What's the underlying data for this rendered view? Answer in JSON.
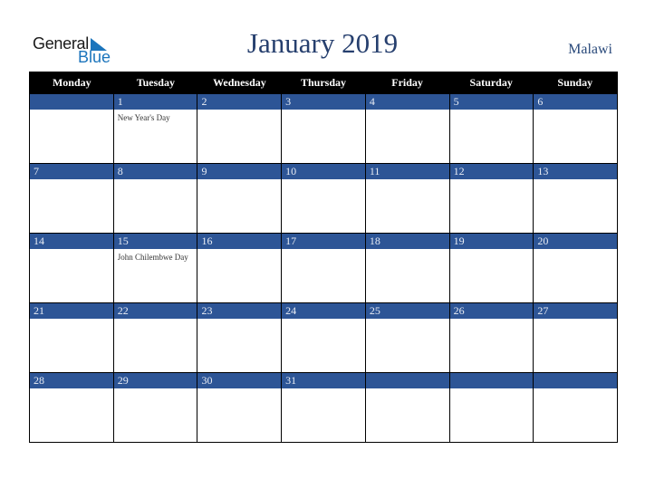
{
  "brand": {
    "general": "General",
    "blue": "Blue"
  },
  "title": "January 2019",
  "country": "Malawi",
  "weekdays": [
    "Monday",
    "Tuesday",
    "Wednesday",
    "Thursday",
    "Friday",
    "Saturday",
    "Sunday"
  ],
  "weeks": [
    [
      {
        "d": ""
      },
      {
        "d": "1",
        "e": "New Year's Day"
      },
      {
        "d": "2"
      },
      {
        "d": "3"
      },
      {
        "d": "4"
      },
      {
        "d": "5"
      },
      {
        "d": "6"
      }
    ],
    [
      {
        "d": "7"
      },
      {
        "d": "8"
      },
      {
        "d": "9"
      },
      {
        "d": "10"
      },
      {
        "d": "11"
      },
      {
        "d": "12"
      },
      {
        "d": "13"
      }
    ],
    [
      {
        "d": "14"
      },
      {
        "d": "15",
        "e": "John Chilembwe Day"
      },
      {
        "d": "16"
      },
      {
        "d": "17"
      },
      {
        "d": "18"
      },
      {
        "d": "19"
      },
      {
        "d": "20"
      }
    ],
    [
      {
        "d": "21"
      },
      {
        "d": "22"
      },
      {
        "d": "23"
      },
      {
        "d": "24"
      },
      {
        "d": "25"
      },
      {
        "d": "26"
      },
      {
        "d": "27"
      }
    ],
    [
      {
        "d": "28"
      },
      {
        "d": "29"
      },
      {
        "d": "30"
      },
      {
        "d": "31"
      },
      {
        "d": ""
      },
      {
        "d": ""
      },
      {
        "d": ""
      }
    ]
  ],
  "colors": {
    "band": "#2d5596",
    "header": "#000000",
    "title": "#263f6e",
    "logo_blue": "#1c75bc"
  }
}
